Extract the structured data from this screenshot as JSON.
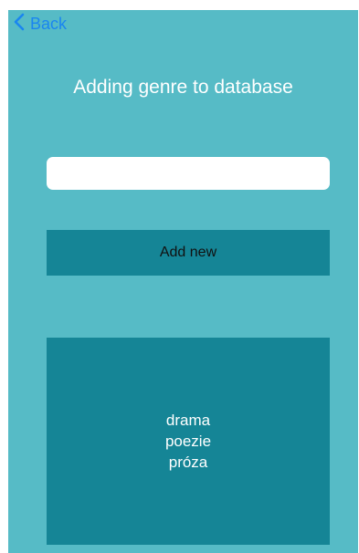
{
  "nav": {
    "back_label": "Back"
  },
  "page": {
    "title": "Adding genre to database"
  },
  "form": {
    "genre_input_value": "",
    "genre_input_placeholder": "",
    "add_button_label": "Add new"
  },
  "genres": [
    "drama",
    "poezie",
    "próza"
  ],
  "colors": {
    "background": "#56bbc6",
    "panel": "#158596",
    "accent": "#1a86f0",
    "text_light": "#ffffff"
  },
  "icons": {
    "back": "chevron-left-icon"
  }
}
